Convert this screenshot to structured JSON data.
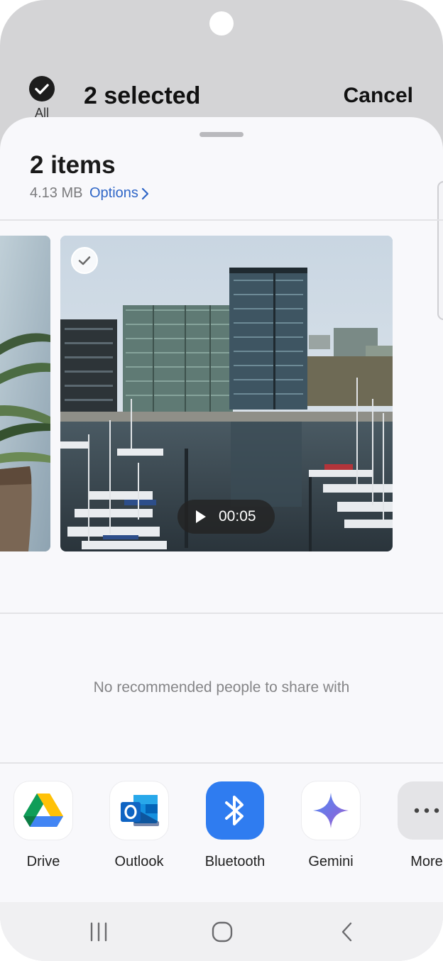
{
  "header": {
    "select_all_label": "All",
    "selected_text": "2 selected",
    "cancel_label": "Cancel"
  },
  "sheet": {
    "items_title": "2 items",
    "size": "4.13 MB",
    "options_label": "Options"
  },
  "media": {
    "video_duration": "00:05"
  },
  "recommendations": {
    "empty_text": "No recommended people to share with"
  },
  "apps": [
    {
      "name": "Drive",
      "icon": "google-drive-icon"
    },
    {
      "name": "Outlook",
      "icon": "outlook-icon"
    },
    {
      "name": "Bluetooth",
      "icon": "bluetooth-icon"
    },
    {
      "name": "Gemini",
      "icon": "gemini-icon"
    },
    {
      "name": "More",
      "icon": "more-icon"
    }
  ],
  "colors": {
    "accent_link": "#2f66c7",
    "bluetooth_blue": "#2f7cf0"
  }
}
